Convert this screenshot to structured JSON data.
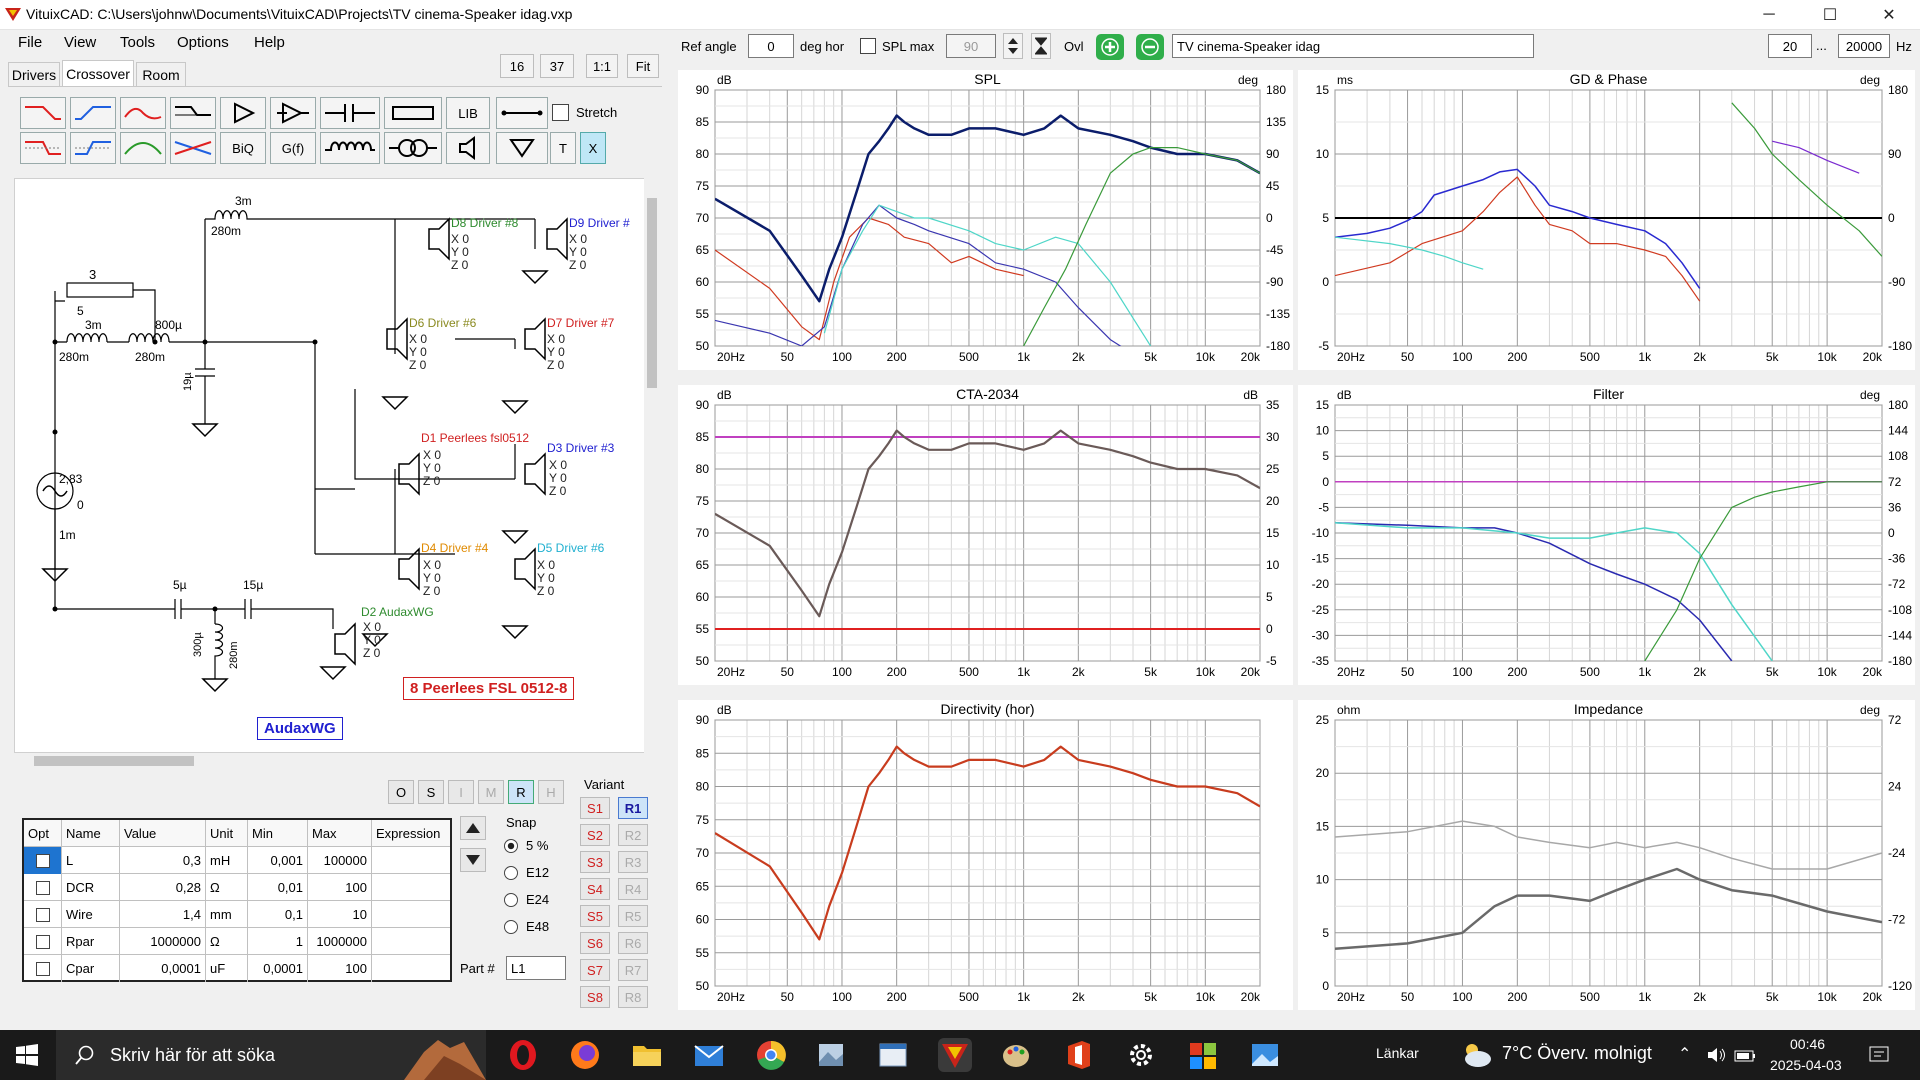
{
  "window": {
    "title": "VituixCAD: C:\\Users\\johnw\\Documents\\VituixCAD\\Projects\\TV cinema-Speaker idag.vxp",
    "minimize": "─",
    "maximize": "☐",
    "close": "✕"
  },
  "menu": [
    "File",
    "View",
    "Tools",
    "Options",
    "Help"
  ],
  "left_toolbar": {
    "zoom_a": "16",
    "zoom_b": "37",
    "one_to_one": "1:1",
    "fit": "Fit"
  },
  "tabs": [
    "Drivers",
    "Crossover",
    "Room"
  ],
  "parts_toolbar": {
    "lib": "LIB",
    "biq": "BiQ",
    "gf": "G(f)",
    "t": "T",
    "x": "X",
    "stretch": "Stretch"
  },
  "schematic": {
    "components": [
      {
        "id": "r1",
        "value": "3",
        "sub": "5"
      },
      {
        "id": "l1",
        "value": "3m",
        "sub": "280m"
      },
      {
        "id": "l2",
        "value": "800µ",
        "sub": "280m"
      },
      {
        "id": "l3",
        "value": "3m",
        "sub": "280m"
      },
      {
        "id": "c1",
        "value": "19µ"
      },
      {
        "id": "gen",
        "value": "2,83",
        "sub": "1m",
        "phase": "0"
      },
      {
        "id": "c2",
        "value": "5µ"
      },
      {
        "id": "c3",
        "value": "15µ"
      },
      {
        "id": "l4",
        "value": "300µ",
        "sub": "280m"
      }
    ],
    "drivers": [
      {
        "label": "D8 Driver #8",
        "color": "#2e8b2e"
      },
      {
        "label": "D9 Driver #",
        "color": "#2020d0"
      },
      {
        "label": "D6 Driver #6",
        "color": "#8a8a20"
      },
      {
        "label": "D7 Driver #7",
        "color": "#d02020"
      },
      {
        "label": "D1 Peerlees fsl0512",
        "color": "#d02020"
      },
      {
        "label": "D3 Driver #3",
        "color": "#2020d0"
      },
      {
        "label": "D4 Driver #4",
        "color": "#e08a00"
      },
      {
        "label": "D5 Driver #6",
        "color": "#20b0d0"
      },
      {
        "label": "D2 AudaxWG",
        "color": "#2e8b2e"
      }
    ],
    "xyz": [
      "X 0",
      "Y 0",
      "Z 0"
    ],
    "note_red": "8 Peerlees FSL 0512-8",
    "note_blue": "AudaxWG"
  },
  "view_buttons": [
    "O",
    "S",
    "I",
    "M",
    "R",
    "H"
  ],
  "variant_title": "Variant",
  "variants_s": [
    "S1",
    "S2",
    "S3",
    "S4",
    "S5",
    "S6",
    "S7",
    "S8"
  ],
  "variants_r": [
    "R1",
    "R2",
    "R3",
    "R4",
    "R5",
    "R6",
    "R7",
    "R8"
  ],
  "param_table": {
    "headers": [
      "Opt",
      "Name",
      "Value",
      "Unit",
      "Min",
      "Max",
      "Expression"
    ],
    "rows": [
      {
        "name": "L",
        "value": "0,3",
        "unit": "mH",
        "min": "0,001",
        "max": "100000",
        "expr": ""
      },
      {
        "name": "DCR",
        "value": "0,28",
        "unit": "Ω",
        "min": "0,01",
        "max": "100",
        "expr": ""
      },
      {
        "name": "Wire",
        "value": "1,4",
        "unit": "mm",
        "min": "0,1",
        "max": "10",
        "expr": ""
      },
      {
        "name": "Rpar",
        "value": "1000000",
        "unit": "Ω",
        "min": "1",
        "max": "1000000",
        "expr": ""
      },
      {
        "name": "Cpar",
        "value": "0,0001",
        "unit": "uF",
        "min": "0,0001",
        "max": "100",
        "expr": ""
      }
    ]
  },
  "snap": {
    "title": "Snap",
    "options": [
      "5 %",
      "E12",
      "E24",
      "E48"
    ],
    "selected": "5 %"
  },
  "part": {
    "label": "Part #",
    "value": "L1"
  },
  "top_bar": {
    "ref_angle_label": "Ref angle",
    "ref_angle": "0",
    "deg_hor": "deg hor",
    "spl_max": "SPL max",
    "spl_max_value": "90",
    "ovl": "Ovl",
    "project": "TV cinema-Speaker idag",
    "f_low": "20",
    "dots": "...",
    "f_high": "20000",
    "hz": "Hz"
  },
  "x_ticks": [
    "20Hz",
    "50",
    "100",
    "200",
    "500",
    "1k",
    "2k",
    "5k",
    "10k",
    "20k"
  ],
  "chart_data": [
    {
      "type": "line",
      "title": "SPL",
      "y_unit": "dB",
      "y2_unit": "deg",
      "ylim": [
        50,
        90
      ],
      "yticks": [
        "90",
        "85",
        "80",
        "75",
        "70",
        "65",
        "60",
        "55",
        "50"
      ],
      "y2ticks": [
        "180",
        "135",
        "90",
        "45",
        "0",
        "-45",
        "-90",
        "-135",
        "-180"
      ],
      "x_scale": "log",
      "xlim": [
        20,
        20000
      ],
      "series": [
        {
          "color": "#0b1d6b",
          "width": 2.5,
          "x": [
            20,
            40,
            60,
            75,
            85,
            100,
            120,
            140,
            160,
            180,
            200,
            220,
            250,
            300,
            400,
            500,
            700,
            1000,
            1300,
            1600,
            2000,
            3000,
            4000,
            5000,
            7000,
            10000,
            15000,
            20000
          ],
          "y": [
            73,
            68,
            61,
            57,
            62,
            67,
            74,
            80,
            82,
            84,
            86,
            85,
            84,
            83,
            83,
            84,
            84,
            83,
            84,
            86,
            84,
            83,
            82,
            81,
            80,
            80,
            79,
            77
          ]
        },
        {
          "color": "#d03a20",
          "width": 1.2,
          "x": [
            20,
            40,
            60,
            75,
            90,
            110,
            140,
            180,
            220,
            300,
            400,
            500,
            700,
            1000
          ],
          "y": [
            65,
            59,
            53,
            51,
            60,
            67,
            70,
            69,
            67,
            66,
            63,
            64,
            62,
            61
          ]
        },
        {
          "color": "#3a36b0",
          "width": 1.2,
          "x": [
            20,
            40,
            60,
            80,
            100,
            130,
            160,
            200,
            250,
            300,
            500,
            700,
            1000,
            1500,
            2000,
            3000,
            5000
          ],
          "y": [
            54,
            52,
            50,
            53,
            62,
            69,
            72,
            70,
            69,
            68,
            66,
            63,
            62,
            60,
            56,
            51,
            47
          ]
        },
        {
          "color": "#4fd6c8",
          "width": 1.2,
          "x": [
            80,
            100,
            130,
            160,
            200,
            250,
            300,
            500,
            700,
            1000,
            1500,
            2000,
            3000,
            5000
          ],
          "y": [
            52,
            62,
            68,
            72,
            71,
            70,
            70,
            68,
            66,
            65,
            67,
            66,
            60,
            50
          ]
        },
        {
          "color": "#3a9a3a",
          "width": 1.2,
          "x": [
            1000,
            1300,
            1700,
            2200,
            3000,
            4000,
            5000,
            7000,
            10000,
            15000,
            20000
          ],
          "y": [
            50,
            56,
            62,
            69,
            77,
            80,
            81,
            81,
            80,
            79,
            77
          ]
        }
      ]
    },
    {
      "type": "line",
      "title": "GD & Phase",
      "y_unit": "ms",
      "y2_unit": "deg",
      "ylim": [
        -5,
        15
      ],
      "yticks": [
        "15",
        "10",
        "5",
        "0",
        "-5"
      ],
      "y2ticks": [
        "180",
        "90",
        "0",
        "-90",
        "-180"
      ],
      "x_scale": "log",
      "xlim": [
        20,
        20000
      ],
      "series": [
        {
          "color": "#000000",
          "width": 2,
          "x": [
            20,
            20000
          ],
          "y": [
            5,
            5
          ]
        },
        {
          "color": "#2a2ad0",
          "width": 1.5,
          "x": [
            20,
            30,
            40,
            50,
            60,
            70,
            100,
            130,
            160,
            200,
            250,
            300,
            400,
            500,
            700,
            1000,
            1300,
            1600,
            2000
          ],
          "y": [
            3.5,
            3.8,
            4.2,
            4.8,
            5.5,
            6.8,
            7.5,
            8.0,
            8.6,
            8.8,
            7.5,
            6.0,
            5.5,
            5.0,
            4.5,
            4.0,
            3.0,
            1.5,
            -0.5
          ]
        },
        {
          "color": "#d03a20",
          "width": 1.2,
          "x": [
            20,
            40,
            60,
            100,
            130,
            160,
            200,
            250,
            300,
            400,
            500,
            700,
            1000,
            1300,
            1600,
            2000
          ],
          "y": [
            0.5,
            1.5,
            3,
            4,
            5.5,
            7,
            8.2,
            6,
            4.5,
            4,
            3,
            3,
            2.5,
            2,
            0.5,
            -1.5
          ]
        },
        {
          "color": "#4fd6c8",
          "width": 1.2,
          "x": [
            20,
            40,
            60,
            80,
            100,
            130
          ],
          "y": [
            3.5,
            3.0,
            2.5,
            2.0,
            1.5,
            1.0
          ]
        },
        {
          "color": "#3a9a3a",
          "width": 1.2,
          "x": [
            3000,
            4000,
            5000,
            7000,
            10000,
            15000,
            20000
          ],
          "y": [
            14,
            12,
            10,
            8,
            6,
            4,
            2
          ]
        },
        {
          "color": "#7a2ad0",
          "width": 1.2,
          "x": [
            5000,
            7000,
            10000,
            15000
          ],
          "y": [
            11,
            10.5,
            9.5,
            8.5
          ]
        }
      ]
    },
    {
      "type": "line",
      "title": "CTA-2034",
      "y_unit": "dB",
      "y2_unit": "dB",
      "ylim": [
        50,
        90
      ],
      "yticks": [
        "90",
        "85",
        "80",
        "75",
        "70",
        "65",
        "60",
        "55",
        "50"
      ],
      "y2ticks": [
        "35",
        "30",
        "25",
        "20",
        "15",
        "10",
        "5",
        "0",
        "-5"
      ],
      "x_scale": "log",
      "xlim": [
        20,
        20000
      ],
      "series": [
        {
          "color": "#c040c0",
          "width": 2,
          "x": [
            20,
            20000
          ],
          "y": [
            85,
            85
          ]
        },
        {
          "color": "#e02020",
          "width": 2,
          "x": [
            20,
            20000
          ],
          "y": [
            55,
            55
          ]
        },
        {
          "color": "#6a5a58",
          "width": 2.2,
          "x": [
            20,
            40,
            60,
            75,
            85,
            100,
            120,
            140,
            160,
            180,
            200,
            220,
            250,
            300,
            400,
            500,
            700,
            1000,
            1300,
            1600,
            2000,
            3000,
            4000,
            5000,
            7000,
            10000,
            15000,
            20000
          ],
          "y": [
            73,
            68,
            61,
            57,
            62,
            67,
            74,
            80,
            82,
            84,
            86,
            85,
            84,
            83,
            83,
            84,
            84,
            83,
            84,
            86,
            84,
            83,
            82,
            81,
            80,
            80,
            79,
            77
          ]
        }
      ]
    },
    {
      "type": "line",
      "title": "Filter",
      "y_unit": "dB",
      "y2_unit": "deg",
      "ylim": [
        -35,
        15
      ],
      "yticks": [
        "15",
        "10",
        "5",
        "0",
        "-5",
        "-10",
        "-15",
        "-20",
        "-25",
        "-30",
        "-35"
      ],
      "y2ticks": [
        "180",
        "144",
        "108",
        "72",
        "36",
        "0",
        "-36",
        "-72",
        "-108",
        "-144",
        "-180"
      ],
      "x_scale": "log",
      "xlim": [
        20,
        20000
      ],
      "series": [
        {
          "color": "#c040c0",
          "width": 1.5,
          "x": [
            20,
            20000
          ],
          "y": [
            0,
            0
          ]
        },
        {
          "color": "#2a2ab0",
          "width": 1.5,
          "x": [
            20,
            50,
            100,
            150,
            200,
            300,
            500,
            700,
            1000,
            1500,
            2000,
            3000
          ],
          "y": [
            -8,
            -8.5,
            -9,
            -9,
            -10,
            -12,
            -16,
            -18,
            -20,
            -23,
            -27,
            -35
          ]
        },
        {
          "color": "#4fd6c8",
          "width": 1.5,
          "x": [
            20,
            50,
            100,
            200,
            300,
            500,
            700,
            1000,
            1500,
            2000,
            3000,
            5000
          ],
          "y": [
            -8,
            -9,
            -9,
            -10,
            -11,
            -11,
            -10,
            -9,
            -10,
            -14,
            -24,
            -35
          ]
        },
        {
          "color": "#3a9a3a",
          "width": 1.2,
          "x": [
            1000,
            1500,
            2000,
            3000,
            4000,
            5000,
            7000,
            10000,
            20000
          ],
          "y": [
            -35,
            -25,
            -15,
            -5,
            -3,
            -2,
            -1,
            0,
            0
          ]
        }
      ]
    },
    {
      "type": "line",
      "title": "Directivity (hor)",
      "y_unit": "dB",
      "ylim": [
        50,
        90
      ],
      "yticks": [
        "90",
        "85",
        "80",
        "75",
        "70",
        "65",
        "60",
        "55",
        "50"
      ],
      "x_scale": "log",
      "xlim": [
        20,
        20000
      ],
      "series": [
        {
          "color": "#c83c1e",
          "width": 2.2,
          "x": [
            20,
            40,
            60,
            75,
            85,
            100,
            120,
            140,
            160,
            180,
            200,
            220,
            250,
            300,
            400,
            500,
            700,
            1000,
            1300,
            1600,
            2000,
            3000,
            4000,
            5000,
            7000,
            10000,
            15000,
            20000
          ],
          "y": [
            73,
            68,
            61,
            57,
            62,
            67,
            74,
            80,
            82,
            84,
            86,
            85,
            84,
            83,
            83,
            84,
            84,
            83,
            84,
            86,
            84,
            83,
            82,
            81,
            80,
            80,
            79,
            77
          ]
        }
      ]
    },
    {
      "type": "line",
      "title": "Impedance",
      "y_unit": "ohm",
      "y2_unit": "deg",
      "ylim": [
        0,
        25
      ],
      "yticks": [
        "25",
        "20",
        "15",
        "10",
        "5",
        "0"
      ],
      "y2ticks": [
        "72",
        "24",
        "-24",
        "-72",
        "-120"
      ],
      "x_scale": "log",
      "xlim": [
        20,
        20000
      ],
      "series": [
        {
          "color": "#a8a8a8",
          "width": 1.5,
          "x": [
            20,
            50,
            100,
            150,
            200,
            300,
            500,
            700,
            1000,
            1500,
            2000,
            3000,
            5000,
            10000,
            20000
          ],
          "y": [
            14,
            14.5,
            15.5,
            15,
            14,
            13.5,
            13,
            13.5,
            13,
            13.5,
            13,
            12,
            11,
            11,
            12.5
          ]
        },
        {
          "color": "#6a6a6a",
          "width": 2.5,
          "x": [
            20,
            50,
            100,
            150,
            200,
            300,
            500,
            700,
            1000,
            1500,
            2000,
            3000,
            5000,
            10000,
            20000
          ],
          "y": [
            3.5,
            4,
            5,
            7.5,
            8.5,
            8.5,
            8,
            9,
            10,
            11,
            10,
            9,
            8.5,
            7,
            6
          ]
        }
      ]
    }
  ],
  "taskbar": {
    "search": "Skriv här för att söka",
    "links": "Länkar",
    "weather": "7°C  Överv. molnigt",
    "time": "00:46",
    "date": "2025-04-03"
  }
}
